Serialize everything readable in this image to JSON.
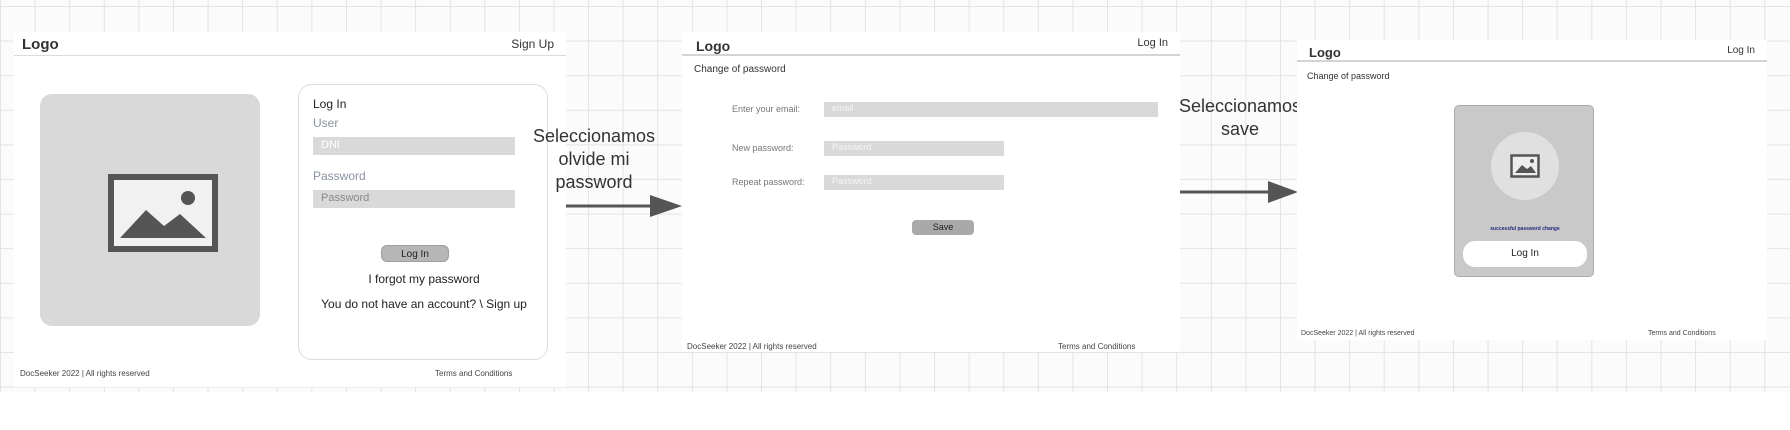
{
  "frames": {
    "login": {
      "logo": "Logo",
      "top_link": "Sign Up",
      "panel": {
        "title": "Log In",
        "user_label": "User",
        "user_placeholder": "DNI",
        "password_label": "Password",
        "password_placeholder": "Password",
        "login_button": "Log In",
        "forgot_link": "I forgot my password",
        "signup_prompt": "You do not have an account? \\ Sign up"
      },
      "footer_left": "DocSeeker 2022 | All rights reserved",
      "footer_right": "Terms and Conditions"
    },
    "change_password": {
      "logo": "Logo",
      "top_link": "Log In",
      "subtitle": "Change of password",
      "email_label": "Enter your email:",
      "email_placeholder": "email",
      "new_password_label": "New password:",
      "new_password_placeholder": "Password",
      "repeat_password_label": "Repeat password:",
      "repeat_password_placeholder": "Password",
      "save_button": "Save",
      "footer_left": "DocSeeker 2022 | All rights reserved",
      "footer_right": "Terms and Conditions"
    },
    "success": {
      "logo": "Logo",
      "top_link": "Log In",
      "subtitle": "Change of password",
      "message": "successful password change",
      "login_button": "Log In",
      "footer_left": "DocSeeker 2022 | All rights reserved",
      "footer_right": "Terms and Conditions"
    }
  },
  "transitions": [
    {
      "label": "Seleccionamos olvide mi password"
    },
    {
      "label": "Seleccionamos save"
    }
  ],
  "colors": {
    "placeholder_gray": "#d9d9d9",
    "button_gray": "#b6b6b6",
    "message_blue": "#1f2a7a",
    "arrow": "#555555"
  },
  "icons": [
    "image-placeholder-icon",
    "arrow-right-icon"
  ]
}
